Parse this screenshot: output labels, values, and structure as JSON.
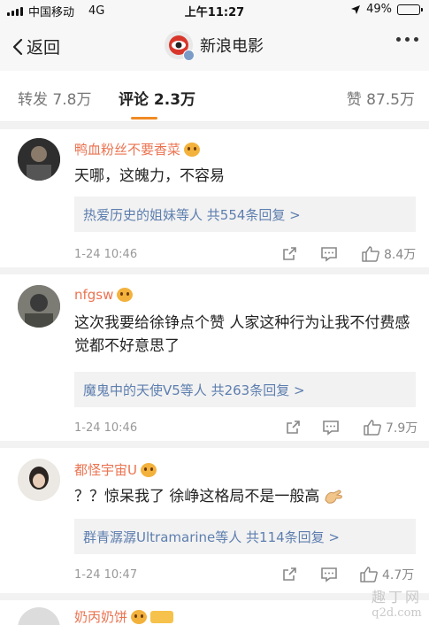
{
  "status_bar": {
    "carrier": "中国移动",
    "network": "4G",
    "time": "上午11:27",
    "battery": "49%",
    "battery_level": 0.49
  },
  "nav": {
    "back_label": "返回",
    "title": "新浪电影"
  },
  "tabs": [
    {
      "label": "转发 7.8万"
    },
    {
      "label": "评论 2.3万"
    },
    {
      "label": "赞 87.5万"
    }
  ],
  "comments": [
    {
      "username": "鸭血粉丝不要香菜",
      "text": "天哪，这魄力，不容易",
      "replies": "热爱历史的姐妹等人  共554条回复 >",
      "time": "1-24 10:46",
      "likes": "8.4万"
    },
    {
      "username": "nfgsw",
      "text": "这次我要给徐铮点个赞 人家这种行为让我不付费感觉都不好意思了",
      "replies": "魔鬼中的天使V5等人  共263条回复 >",
      "time": "1-24 10:46",
      "likes": "7.9万"
    },
    {
      "username": "都怪宇宙U",
      "text": "？？惊呆我了 徐峥这格局不是一般高",
      "replies": "群青潺潺Ultramarine等人  共114条回复 >",
      "time": "1-24 10:47",
      "likes": "4.7万"
    },
    {
      "username": "奶丙奶饼"
    }
  ],
  "watermark": {
    "line1": "趣丁网",
    "line2": "q2d.com"
  }
}
